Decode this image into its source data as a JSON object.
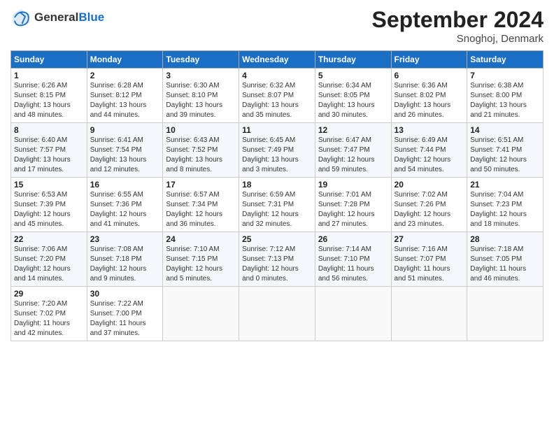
{
  "logo": {
    "text_general": "General",
    "text_blue": "Blue"
  },
  "header": {
    "month": "September 2024",
    "location": "Snoghoj, Denmark"
  },
  "weekdays": [
    "Sunday",
    "Monday",
    "Tuesday",
    "Wednesday",
    "Thursday",
    "Friday",
    "Saturday"
  ],
  "weeks": [
    [
      {
        "day": "1",
        "sunrise": "Sunrise: 6:26 AM",
        "sunset": "Sunset: 8:15 PM",
        "daylight": "Daylight: 13 hours and 48 minutes."
      },
      {
        "day": "2",
        "sunrise": "Sunrise: 6:28 AM",
        "sunset": "Sunset: 8:12 PM",
        "daylight": "Daylight: 13 hours and 44 minutes."
      },
      {
        "day": "3",
        "sunrise": "Sunrise: 6:30 AM",
        "sunset": "Sunset: 8:10 PM",
        "daylight": "Daylight: 13 hours and 39 minutes."
      },
      {
        "day": "4",
        "sunrise": "Sunrise: 6:32 AM",
        "sunset": "Sunset: 8:07 PM",
        "daylight": "Daylight: 13 hours and 35 minutes."
      },
      {
        "day": "5",
        "sunrise": "Sunrise: 6:34 AM",
        "sunset": "Sunset: 8:05 PM",
        "daylight": "Daylight: 13 hours and 30 minutes."
      },
      {
        "day": "6",
        "sunrise": "Sunrise: 6:36 AM",
        "sunset": "Sunset: 8:02 PM",
        "daylight": "Daylight: 13 hours and 26 minutes."
      },
      {
        "day": "7",
        "sunrise": "Sunrise: 6:38 AM",
        "sunset": "Sunset: 8:00 PM",
        "daylight": "Daylight: 13 hours and 21 minutes."
      }
    ],
    [
      {
        "day": "8",
        "sunrise": "Sunrise: 6:40 AM",
        "sunset": "Sunset: 7:57 PM",
        "daylight": "Daylight: 13 hours and 17 minutes."
      },
      {
        "day": "9",
        "sunrise": "Sunrise: 6:41 AM",
        "sunset": "Sunset: 7:54 PM",
        "daylight": "Daylight: 13 hours and 12 minutes."
      },
      {
        "day": "10",
        "sunrise": "Sunrise: 6:43 AM",
        "sunset": "Sunset: 7:52 PM",
        "daylight": "Daylight: 13 hours and 8 minutes."
      },
      {
        "day": "11",
        "sunrise": "Sunrise: 6:45 AM",
        "sunset": "Sunset: 7:49 PM",
        "daylight": "Daylight: 13 hours and 3 minutes."
      },
      {
        "day": "12",
        "sunrise": "Sunrise: 6:47 AM",
        "sunset": "Sunset: 7:47 PM",
        "daylight": "Daylight: 12 hours and 59 minutes."
      },
      {
        "day": "13",
        "sunrise": "Sunrise: 6:49 AM",
        "sunset": "Sunset: 7:44 PM",
        "daylight": "Daylight: 12 hours and 54 minutes."
      },
      {
        "day": "14",
        "sunrise": "Sunrise: 6:51 AM",
        "sunset": "Sunset: 7:41 PM",
        "daylight": "Daylight: 12 hours and 50 minutes."
      }
    ],
    [
      {
        "day": "15",
        "sunrise": "Sunrise: 6:53 AM",
        "sunset": "Sunset: 7:39 PM",
        "daylight": "Daylight: 12 hours and 45 minutes."
      },
      {
        "day": "16",
        "sunrise": "Sunrise: 6:55 AM",
        "sunset": "Sunset: 7:36 PM",
        "daylight": "Daylight: 12 hours and 41 minutes."
      },
      {
        "day": "17",
        "sunrise": "Sunrise: 6:57 AM",
        "sunset": "Sunset: 7:34 PM",
        "daylight": "Daylight: 12 hours and 36 minutes."
      },
      {
        "day": "18",
        "sunrise": "Sunrise: 6:59 AM",
        "sunset": "Sunset: 7:31 PM",
        "daylight": "Daylight: 12 hours and 32 minutes."
      },
      {
        "day": "19",
        "sunrise": "Sunrise: 7:01 AM",
        "sunset": "Sunset: 7:28 PM",
        "daylight": "Daylight: 12 hours and 27 minutes."
      },
      {
        "day": "20",
        "sunrise": "Sunrise: 7:02 AM",
        "sunset": "Sunset: 7:26 PM",
        "daylight": "Daylight: 12 hours and 23 minutes."
      },
      {
        "day": "21",
        "sunrise": "Sunrise: 7:04 AM",
        "sunset": "Sunset: 7:23 PM",
        "daylight": "Daylight: 12 hours and 18 minutes."
      }
    ],
    [
      {
        "day": "22",
        "sunrise": "Sunrise: 7:06 AM",
        "sunset": "Sunset: 7:20 PM",
        "daylight": "Daylight: 12 hours and 14 minutes."
      },
      {
        "day": "23",
        "sunrise": "Sunrise: 7:08 AM",
        "sunset": "Sunset: 7:18 PM",
        "daylight": "Daylight: 12 hours and 9 minutes."
      },
      {
        "day": "24",
        "sunrise": "Sunrise: 7:10 AM",
        "sunset": "Sunset: 7:15 PM",
        "daylight": "Daylight: 12 hours and 5 minutes."
      },
      {
        "day": "25",
        "sunrise": "Sunrise: 7:12 AM",
        "sunset": "Sunset: 7:13 PM",
        "daylight": "Daylight: 12 hours and 0 minutes."
      },
      {
        "day": "26",
        "sunrise": "Sunrise: 7:14 AM",
        "sunset": "Sunset: 7:10 PM",
        "daylight": "Daylight: 11 hours and 56 minutes."
      },
      {
        "day": "27",
        "sunrise": "Sunrise: 7:16 AM",
        "sunset": "Sunset: 7:07 PM",
        "daylight": "Daylight: 11 hours and 51 minutes."
      },
      {
        "day": "28",
        "sunrise": "Sunrise: 7:18 AM",
        "sunset": "Sunset: 7:05 PM",
        "daylight": "Daylight: 11 hours and 46 minutes."
      }
    ],
    [
      {
        "day": "29",
        "sunrise": "Sunrise: 7:20 AM",
        "sunset": "Sunset: 7:02 PM",
        "daylight": "Daylight: 11 hours and 42 minutes."
      },
      {
        "day": "30",
        "sunrise": "Sunrise: 7:22 AM",
        "sunset": "Sunset: 7:00 PM",
        "daylight": "Daylight: 11 hours and 37 minutes."
      },
      null,
      null,
      null,
      null,
      null
    ]
  ]
}
